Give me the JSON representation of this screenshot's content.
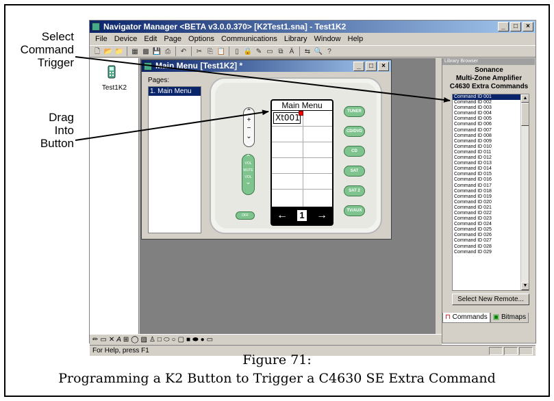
{
  "annotations": {
    "select_trigger": "Select\nCommand\nTrigger",
    "drag_into": "Drag\nInto\nButton"
  },
  "app": {
    "title": "Navigator Manager <BETA v3.0.0.370> [K2Test1.sna] - Test1K2",
    "menu": [
      "File",
      "Device",
      "Edit",
      "Page",
      "Options",
      "Communications",
      "Library",
      "Window",
      "Help"
    ],
    "window_buttons": [
      "_",
      "□",
      "×"
    ]
  },
  "toolbar": {
    "icons": [
      "new-icon",
      "open-icon",
      "open-folder-icon",
      "grid-icon",
      "grid2-icon",
      "save-icon",
      "print-icon",
      "undo-icon",
      "cut-icon",
      "copy-icon",
      "paste-icon",
      "page-icon",
      "lock-icon",
      "wand-icon",
      "page2-icon",
      "pages-icon",
      "font-icon",
      "transfer-icon",
      "preview-icon",
      "help-icon"
    ]
  },
  "device": {
    "label": "Test1K2"
  },
  "child_window": {
    "title": "Main Menu [Test1K2] *",
    "pages_label": "Pages:",
    "pages": [
      "1. Main Menu"
    ]
  },
  "remote": {
    "screen_title": "Main Menu",
    "button_label": "Xt001",
    "page_number": "1",
    "left_arrow": "←",
    "right_arrow": "→",
    "side_buttons": [
      "TUNER",
      "CD/DVD",
      "CD",
      "SAT",
      "SAT 2",
      "TV/AUX"
    ],
    "rocker_labels": [
      "VOL",
      "MUTE",
      "VOL"
    ],
    "off_label": "OFF"
  },
  "library": {
    "title": "Library Browser",
    "brand": "Sonance",
    "product": "Multi-Zone Amplifier",
    "set": "C4630 Extra Commands",
    "commands": [
      "Command ID 001",
      "Command ID 002",
      "Command ID 003",
      "Command ID 004",
      "Command ID 005",
      "Command ID 006",
      "Command ID 007",
      "Command ID 008",
      "Command ID 009",
      "Command ID 010",
      "Command ID 011",
      "Command ID 012",
      "Command ID 013",
      "Command ID 014",
      "Command ID 015",
      "Command ID 016",
      "Command ID 017",
      "Command ID 018",
      "Command ID 019",
      "Command ID 020",
      "Command ID 021",
      "Command ID 022",
      "Command ID 023",
      "Command ID 024",
      "Command ID 025",
      "Command ID 026",
      "Command ID 027",
      "Command ID 028",
      "Command ID 029"
    ],
    "selected_index": 0,
    "new_remote_label": "Select New Remote...",
    "tabs": [
      "Commands",
      "Bitmaps"
    ]
  },
  "status": {
    "text": "For Help, press F1"
  },
  "caption": {
    "line1": "Figure 71:",
    "line2": "Programming a K2 Button to Trigger a C4630 SE Extra Command"
  }
}
